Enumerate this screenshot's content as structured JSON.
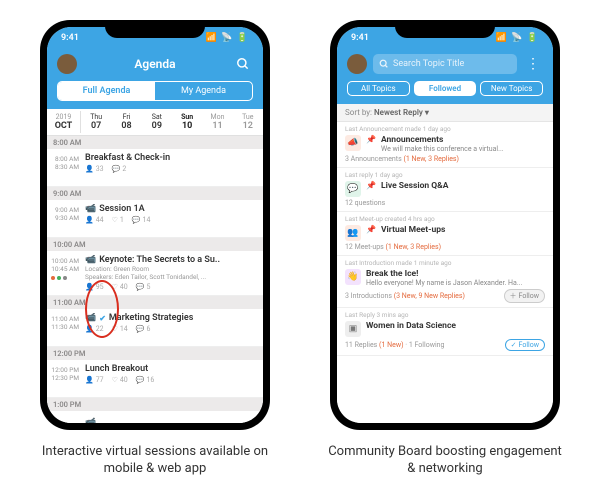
{
  "status": {
    "time": "9:41"
  },
  "agenda": {
    "header_title": "Agenda",
    "tabs": {
      "full": "Full Agenda",
      "my": "My Agenda"
    },
    "date": {
      "year": "2019",
      "month": "OCT",
      "days": [
        {
          "dow": "Thu",
          "num": "07"
        },
        {
          "dow": "Fri",
          "num": "08"
        },
        {
          "dow": "Sat",
          "num": "09"
        },
        {
          "dow": "Sun",
          "num": "10"
        },
        {
          "dow": "Mon",
          "num": "11"
        },
        {
          "dow": "Tue",
          "num": "12"
        }
      ]
    },
    "slots": {
      "t800": "8:00 AM",
      "breakfast": {
        "start": "8:00 AM",
        "end": "8:30 AM",
        "title": "Breakfast & Check-in",
        "attendees": "33",
        "comments": "2"
      },
      "t900": "9:00 AM",
      "session1a": {
        "start": "9:00 AM",
        "end": "9:30 AM",
        "title": "Session 1A",
        "attendees": "44",
        "likes": "1",
        "comments": "14"
      },
      "t1000": "10:00 AM",
      "keynote": {
        "start": "10:00 AM",
        "end": "10:45 AM",
        "title": "Keynote: The Secrets to a Su..",
        "loc": "Location: Green Room",
        "speakers": "Speakers: Eden Tailor, Scott Tonidandel, ...",
        "attendees": "95",
        "likes": "40",
        "comments": "5"
      },
      "t1100": "11:00 AM",
      "marketing": {
        "start": "11:00 AM",
        "end": "11:30 AM",
        "title": "Marketing Strategies",
        "attendees": "22",
        "likes": "14",
        "comments": "6"
      },
      "t1200": "12:00 PM",
      "lunch": {
        "start": "12:00 PM",
        "end": "12:30 PM",
        "title": "Lunch Breakout",
        "attendees": "77",
        "likes": "40",
        "comments": "16"
      },
      "t1300": "1:00 PM"
    }
  },
  "board": {
    "search_placeholder": "Search Topic Title",
    "tabs": {
      "all": "All Topics",
      "followed": "Followed",
      "new": "New Topics"
    },
    "sort_label": "Sort by:",
    "sort_value": "Newest Reply",
    "items": {
      "announcements": {
        "meta": "Last Announcement made 1 day ago",
        "title": "Announcements",
        "sub": "We will make this conference a virtual...",
        "foot_count": "3 Announcements",
        "foot_new": "(1 New, 3 Replies)"
      },
      "qna": {
        "meta": "Last reply 1 day ago",
        "title": "Live Session Q&A",
        "foot_count": "12 questions"
      },
      "meetups": {
        "meta": "Last Meet-up created 4 hrs ago",
        "title": "Virtual Meet-ups",
        "foot_count": "12 Meet-ups",
        "foot_new": "(1 New, 3 Replies)"
      },
      "ice": {
        "meta": "Last Introduction made 1 minute ago",
        "title": "Break the Ice!",
        "sub": "Hello everyone! My name is Jason Alexander. Ha...",
        "foot_count": "3 Introductions",
        "foot_new": "(3 New, 9 New Replies)",
        "follow": "Follow"
      },
      "women": {
        "meta": "Last Reply 3 mins ago",
        "title": "Women in Data Science",
        "foot_count": "11 Replies",
        "foot_new": "(1 New)",
        "foot_following": "1 Following",
        "follow": "Follow"
      }
    }
  },
  "captions": {
    "left": "Interactive virtual sessions available on mobile & web app",
    "right": "Community Board boosting engagement & networking"
  }
}
